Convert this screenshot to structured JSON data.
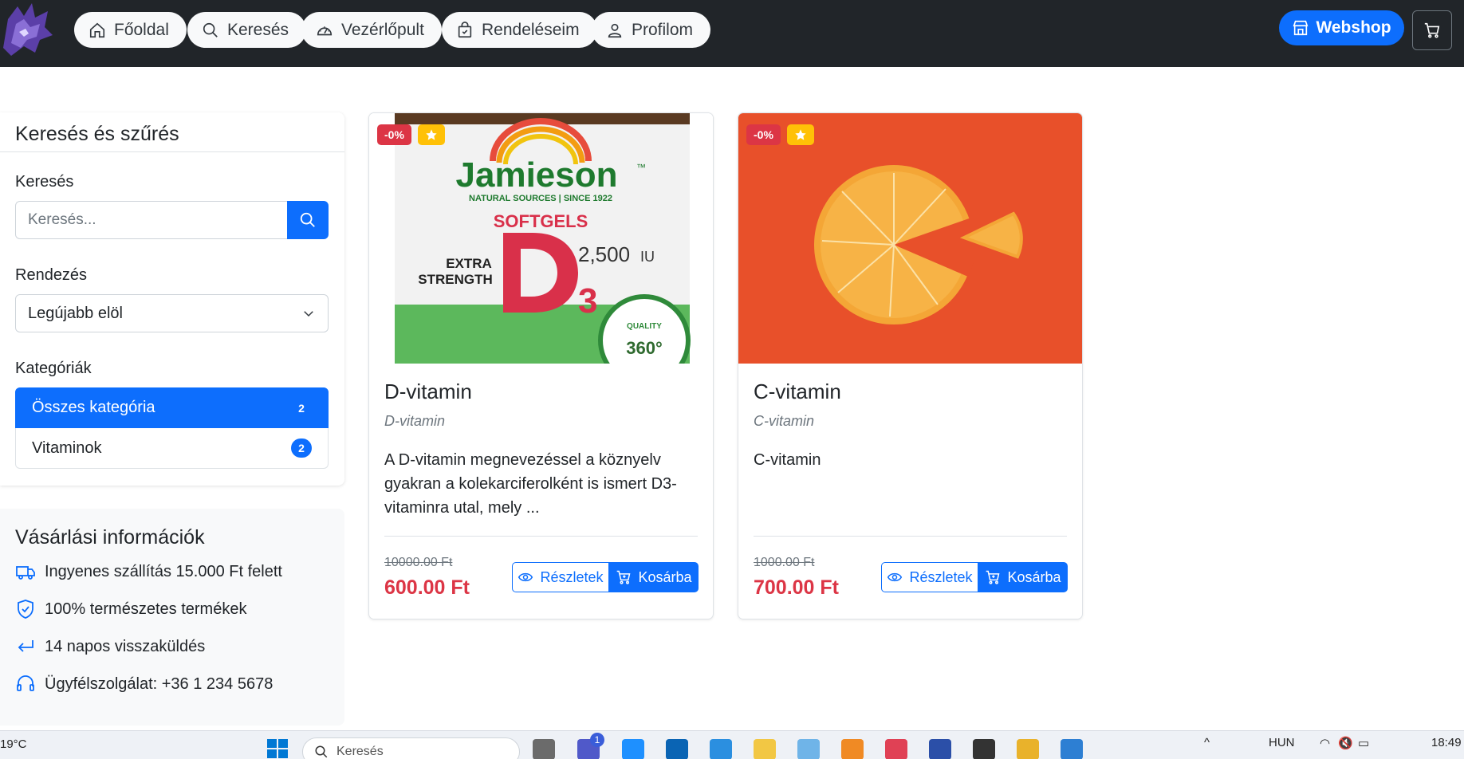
{
  "nav": {
    "items": [
      {
        "label": "Főoldal",
        "icon": "house-icon"
      },
      {
        "label": "Keresés",
        "icon": "search-icon"
      },
      {
        "label": "Vezérlőpult",
        "icon": "speedometer-icon"
      },
      {
        "label": "Rendeléseim",
        "icon": "bag-check-icon"
      },
      {
        "label": "Profilom",
        "icon": "person-icon"
      }
    ],
    "webshop_label": "Webshop"
  },
  "filter": {
    "title": "Keresés és szűrés",
    "search_label": "Keresés",
    "search_placeholder": "Keresés...",
    "sort_label": "Rendezés",
    "sort_value": "Legújabb elöl",
    "categories_label": "Kategóriák",
    "categories": [
      {
        "name": "Összes kategória",
        "count": "2",
        "active": true
      },
      {
        "name": "Vitaminok",
        "count": "2",
        "active": false
      }
    ]
  },
  "info": {
    "title": "Vásárlási információk",
    "rows": [
      {
        "text": "Ingyenes szállítás 15.000 Ft felett",
        "icon": "truck-icon"
      },
      {
        "text": "100% természetes termékek",
        "icon": "shield-check-icon"
      },
      {
        "text": "14 napos visszaküldés",
        "icon": "return-arrow-icon"
      },
      {
        "text": "Ügyfélszolgálat: +36 1 234 5678",
        "icon": "headset-icon"
      }
    ]
  },
  "products": [
    {
      "discount": "-0%",
      "title": "D-vitamin",
      "subtitle": "D-vitamin",
      "description": "A D-vitamin megnevezéssel a köznyelv gyakran a kolekarciferolként is ismert D3-vitaminra utal, mely ...",
      "old_price": "10000.00 Ft",
      "new_price": "600.00 Ft",
      "details_label": "Részletek",
      "cart_label": "Kosárba",
      "image_text": {
        "brand": "Jamieson",
        "brand_tm": "™",
        "tagline": "NATURAL SOURCES | SINCE 1922",
        "type": "SOFTGELS",
        "strength_1": "EXTRA",
        "strength_2": "STRENGTH",
        "dose": "2,500",
        "unit": "IU",
        "seal": "360°",
        "seal_arc": "QUALITY"
      }
    },
    {
      "discount": "-0%",
      "title": "C-vitamin",
      "subtitle": "C-vitamin",
      "description": "C-vitamin",
      "old_price": "1000.00 Ft",
      "new_price": "700.00 Ft",
      "details_label": "Részletek",
      "cart_label": "Kosárba"
    }
  ],
  "taskbar": {
    "weather": "19°C",
    "search_placeholder": "Keresés",
    "language": "HUN",
    "time": "18:49",
    "teams_badge": "1"
  },
  "colors": {
    "primary": "#0d6efd",
    "danger": "#dc3545",
    "warning": "#ffc107",
    "navbar": "#212529"
  }
}
